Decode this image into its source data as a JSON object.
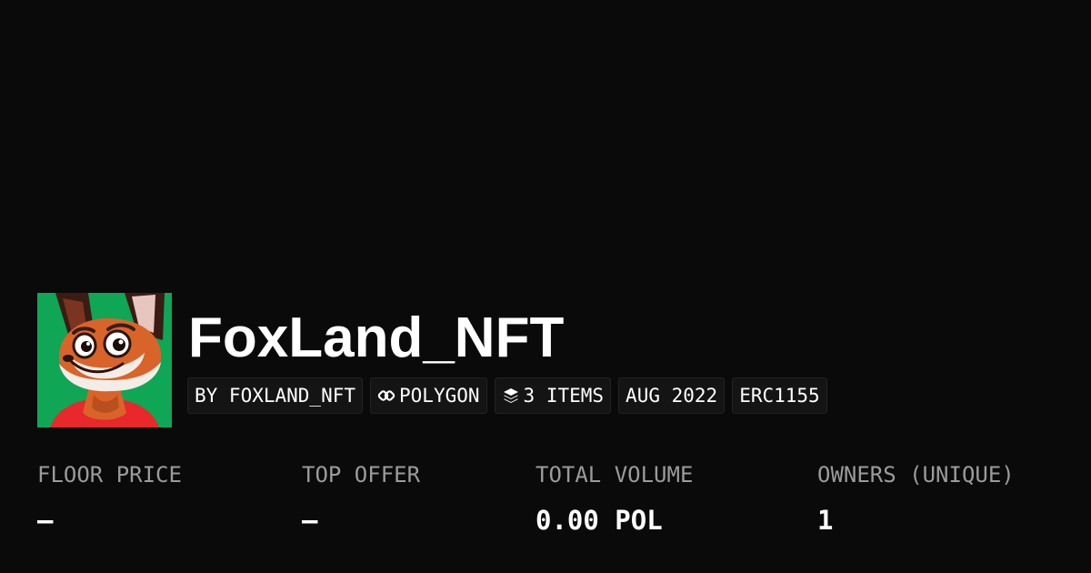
{
  "collection": {
    "name": "FoxLand_NFT",
    "avatar_icon": "fox-avatar-icon",
    "avatar_background": "#0fa655"
  },
  "tags": {
    "creator": "BY FOXLAND_NFT",
    "chain": "POLYGON",
    "chain_icon": "polygon-link-icon",
    "items": "3 ITEMS",
    "items_icon": "layers-icon",
    "date": "AUG 2022",
    "standard": "ERC1155"
  },
  "stats": [
    {
      "label": "FLOOR PRICE",
      "value": "–"
    },
    {
      "label": "TOP OFFER",
      "value": "–"
    },
    {
      "label": "TOTAL VOLUME",
      "value": "0.00 POL"
    },
    {
      "label": "OWNERS (UNIQUE)",
      "value": "1"
    }
  ],
  "colors": {
    "background": "#0a0a0a",
    "text": "#ffffff",
    "label": "#9b9b9b",
    "tag_background": "#141414"
  }
}
